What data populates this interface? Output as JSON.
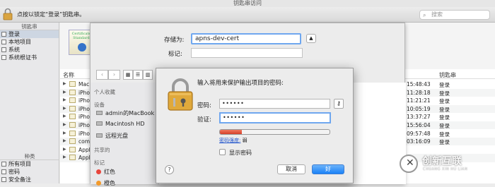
{
  "window": {
    "title": "钥匙串访问"
  },
  "toolbar": {
    "lock_text": "点按以锁定“登录”钥匙串。",
    "search_placeholder": "搜索"
  },
  "sidebar": {
    "keychains_header": "钥匙串",
    "keychains": [
      {
        "label": "登录",
        "selected": true
      },
      {
        "label": "本地项目",
        "selected": false
      },
      {
        "label": "系统",
        "selected": false
      },
      {
        "label": "系统根证书",
        "selected": false
      }
    ],
    "categories_header": "种类",
    "categories": [
      {
        "label": "所有项目"
      },
      {
        "label": "密码"
      },
      {
        "label": "安全备注"
      }
    ]
  },
  "main": {
    "cert_caption": "Certificate Standard",
    "columns": {
      "name": "名称",
      "keychain": "钥匙串"
    },
    "rows": [
      {
        "name": "Mac",
        "date": "15:48:43",
        "keychain": "登录"
      },
      {
        "name": "iPho",
        "date": "11:28:18",
        "keychain": "登录"
      },
      {
        "name": "iPho",
        "date": "11:21:21",
        "keychain": "登录"
      },
      {
        "name": "iPho",
        "date": "10:05:19",
        "keychain": "登录"
      },
      {
        "name": "iPho",
        "date": "13:37:27",
        "keychain": "登录"
      },
      {
        "name": "iPho",
        "date": "15:56:04",
        "keychain": "登录"
      },
      {
        "name": "iPho",
        "date": "09:57:48",
        "keychain": "登录"
      },
      {
        "name": "com",
        "date": "03:16:09",
        "keychain": "登录"
      },
      {
        "name": "Appl",
        "date": "",
        "keychain": ""
      },
      {
        "name": "Appl",
        "date": "",
        "keychain": ""
      }
    ]
  },
  "save_sheet": {
    "save_as_label": "存储为:",
    "save_as_value": "apns-dev-cert",
    "tags_label": "标记:",
    "sidebar": {
      "recent_header": "个人收藏",
      "devices_header": "设备",
      "devices": [
        {
          "label": "admin的MacBook"
        },
        {
          "label": "Macintosh HD"
        },
        {
          "label": "远程光盘"
        }
      ],
      "shared_header": "共享的",
      "tags_header": "标记",
      "tags": [
        {
          "label": "红色",
          "color": "#e8453c"
        },
        {
          "label": "橙色",
          "color": "#f39a2b"
        }
      ]
    }
  },
  "password_dialog": {
    "title": "输入将用来保护输出项目的密码:",
    "password_label": "密码:",
    "password_value": "••••••",
    "verify_label": "验证:",
    "verify_value": "••••••",
    "strength_fraction": 0.2,
    "strength_label": "密码强度:",
    "strength_value": "弱",
    "show_password_label": "显示密码",
    "help_label": "?",
    "cancel_label": "取消",
    "ok_label": "好"
  },
  "watermark": {
    "text": "创新互联",
    "subtext": "CHUANG XIN HU LIAN"
  }
}
